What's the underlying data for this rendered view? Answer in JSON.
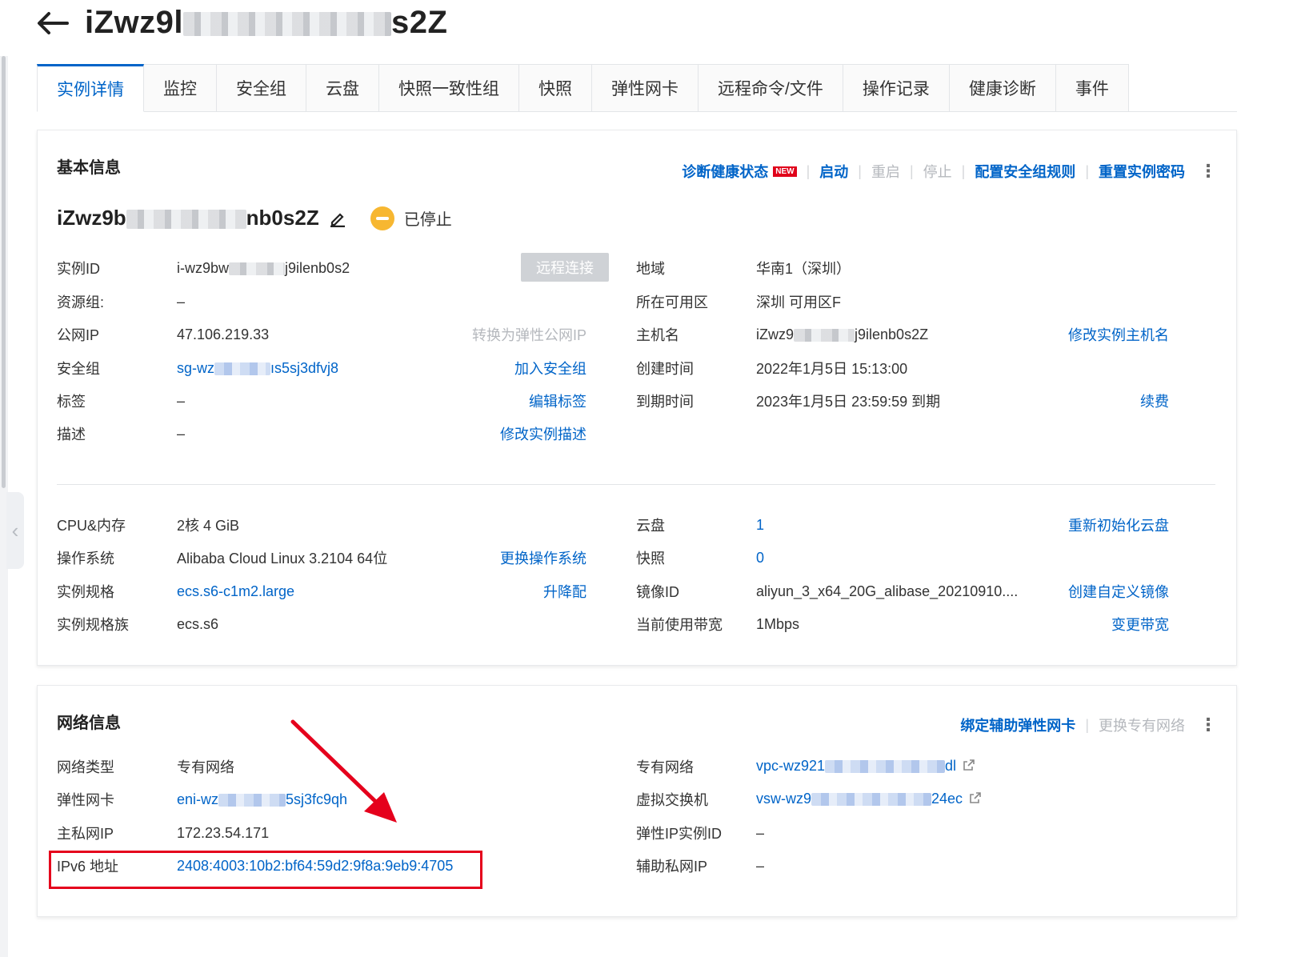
{
  "header": {
    "title_prefix": "iZwz9l",
    "title_suffix": "s2Z"
  },
  "tabs": [
    "实例详情",
    "监控",
    "安全组",
    "云盘",
    "快照一致性组",
    "快照",
    "弹性网卡",
    "远程命令/文件",
    "操作记录",
    "健康诊断",
    "事件"
  ],
  "basic": {
    "title": "基本信息",
    "actions": {
      "diagnose": "诊断健康状态",
      "new_badge": "NEW",
      "start": "启动",
      "restart": "重启",
      "stop": "停止",
      "config_sg": "配置安全组规则",
      "reset_pwd": "重置实例密码"
    },
    "instance_name_prefix": "iZwz9b",
    "instance_name_suffix": "nb0s2Z",
    "status": "已停止",
    "remote_connect": "远程连接",
    "left_rows": [
      {
        "label": "实例ID",
        "prefix": "i-wz9bw",
        "suffix": "j9ilenb0s2"
      },
      {
        "label": "资源组:",
        "value": "–"
      },
      {
        "label": "公网IP",
        "value": "47.106.219.33",
        "op": "转换为弹性公网IP"
      },
      {
        "label": "安全组",
        "prefix": "sg-wz",
        "suffix": "ıs5sj3dfvj8",
        "op": "加入安全组"
      },
      {
        "label": "标签",
        "value": "–",
        "op": "编辑标签"
      },
      {
        "label": "描述",
        "value": "–",
        "op": "修改实例描述"
      }
    ],
    "right_rows": [
      {
        "label": "地域",
        "value": "华南1（深圳）"
      },
      {
        "label": "所在可用区",
        "value": "深圳 可用区F"
      },
      {
        "label": "主机名",
        "prefix": "iZwz9",
        "suffix": "j9ilenb0s2Z",
        "op": "修改实例主机名"
      },
      {
        "label": "创建时间",
        "value": "2022年1月5日 15:13:00"
      },
      {
        "label": "到期时间",
        "value": "2023年1月5日 23:59:59 到期",
        "op": "续费"
      }
    ],
    "left_rows2": [
      {
        "label": "CPU&内存",
        "value": "2核 4 GiB"
      },
      {
        "label": "操作系统",
        "value": "Alibaba Cloud Linux 3.2104 64位",
        "op": "更换操作系统"
      },
      {
        "label": "实例规格",
        "value": "ecs.s6-c1m2.large",
        "op": "升降配"
      },
      {
        "label": "实例规格族",
        "value": "ecs.s6"
      }
    ],
    "right_rows2": [
      {
        "label": "云盘",
        "value": "1",
        "op": "重新初始化云盘"
      },
      {
        "label": "快照",
        "value": "0"
      },
      {
        "label": "镜像ID",
        "value": "aliyun_3_x64_20G_alibase_20210910....",
        "op": "创建自定义镜像"
      },
      {
        "label": "当前使用带宽",
        "value": "1Mbps",
        "op": "变更带宽"
      }
    ]
  },
  "network": {
    "title": "网络信息",
    "actions": {
      "bind_eni": "绑定辅助弹性网卡",
      "change_vpc": "更换专有网络"
    },
    "left_rows": [
      {
        "label": "网络类型",
        "value": "专有网络"
      },
      {
        "label": "弹性网卡",
        "prefix": "eni-wz",
        "suffix": "5sj3fc9qh"
      },
      {
        "label": "主私网IP",
        "value": "172.23.54.171"
      },
      {
        "label": "IPv6 地址",
        "value": "2408:4003:10b2:bf64:59d2:9f8a:9eb9:4705"
      }
    ],
    "right_rows": [
      {
        "label": "专有网络",
        "prefix": "vpc-wz921",
        "suffix": "dl"
      },
      {
        "label": "虚拟交换机",
        "prefix": "vsw-wz9",
        "suffix": "24ec"
      },
      {
        "label": "弹性IP实例ID",
        "value": "–"
      },
      {
        "label": "辅助私网IP",
        "value": "–"
      }
    ]
  },
  "colors": {
    "link": "#0064c8",
    "highlight": "#e5001c",
    "status": "#f7b731"
  }
}
